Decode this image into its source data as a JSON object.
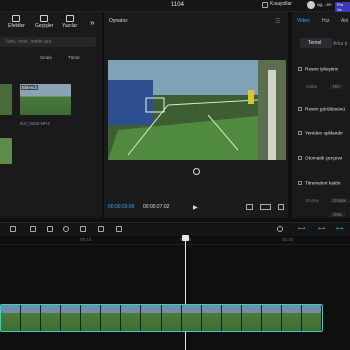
{
  "window": {
    "title": "1104"
  },
  "topbar": {
    "shortcuts_label": "Kısayollar",
    "user": "ug…en",
    "pro_badge": "Pro Ve"
  },
  "media_tools": [
    {
      "label": "Efektler",
      "icon": "sparkle-icon"
    },
    {
      "label": "Geçişler",
      "icon": "transition-icon"
    },
    {
      "label": "Yazılar",
      "icon": "text-icon"
    }
  ],
  "media": {
    "search_placeholder": "İsim, renk, metin ara",
    "sort_label": "Sırala",
    "filter_label": "Tümü",
    "added_badge": "Eklendi",
    "clip_name": "DJI_0260.MP4"
  },
  "player": {
    "title": "Oynatıcı",
    "current_time": "00:00:20:09",
    "total_time": "00:00:27:02"
  },
  "inspector": {
    "tabs": [
      "Video",
      "Hız",
      "Ani"
    ],
    "subtabs": [
      "Temel",
      "Arka p"
    ],
    "options": [
      {
        "label": "Resmi iyileştirin"
      },
      {
        "label": "Resim gürültüsünü"
      },
      {
        "label": "Yeniden ışıklandır"
      },
      {
        "label": "Otomatik çerçeve"
      },
      {
        "label": "Titremeleri kaldır"
      }
    ],
    "hd_value": "HD",
    "level_label": "Düzey",
    "level_value": "Düşük",
    "level_value2": "Orta"
  },
  "timeline": {
    "ruler_labels": [
      "00:10",
      "00:20",
      "00:30"
    ]
  },
  "colors": {
    "accent": "#2bd3c7",
    "timecode": "#3aa0ff"
  }
}
